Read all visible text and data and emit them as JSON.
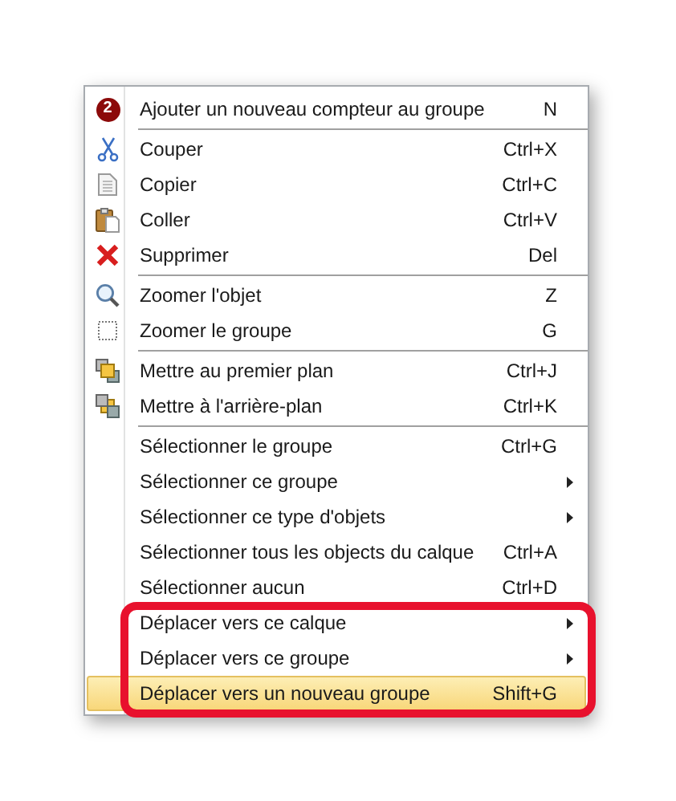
{
  "menu": {
    "items": [
      {
        "kind": "item",
        "badge": "2",
        "label": "Ajouter un nouveau compteur au groupe",
        "shortcut": "N",
        "submenu": false,
        "selected": false,
        "annotated": false
      },
      {
        "kind": "separator"
      },
      {
        "kind": "item",
        "label": "Couper",
        "shortcut": "Ctrl+X",
        "submenu": false,
        "selected": false,
        "annotated": false
      },
      {
        "kind": "item",
        "label": "Copier",
        "shortcut": "Ctrl+C",
        "submenu": false,
        "selected": false,
        "annotated": false
      },
      {
        "kind": "item",
        "label": "Coller",
        "shortcut": "Ctrl+V",
        "submenu": false,
        "selected": false,
        "annotated": false
      },
      {
        "kind": "item",
        "label": "Supprimer",
        "shortcut": "Del",
        "submenu": false,
        "selected": false,
        "annotated": false
      },
      {
        "kind": "separator"
      },
      {
        "kind": "item",
        "label": "Zoomer l'objet",
        "shortcut": "Z",
        "submenu": false,
        "selected": false,
        "annotated": false
      },
      {
        "kind": "item",
        "label": "Zoomer le groupe",
        "shortcut": "G",
        "submenu": false,
        "selected": false,
        "annotated": false
      },
      {
        "kind": "separator"
      },
      {
        "kind": "item",
        "label": "Mettre au premier plan",
        "shortcut": "Ctrl+J",
        "submenu": false,
        "selected": false,
        "annotated": false
      },
      {
        "kind": "item",
        "label": "Mettre à l'arrière-plan",
        "shortcut": "Ctrl+K",
        "submenu": false,
        "selected": false,
        "annotated": false
      },
      {
        "kind": "separator"
      },
      {
        "kind": "item",
        "label": "Sélectionner le groupe",
        "shortcut": "Ctrl+G",
        "submenu": false,
        "selected": false,
        "annotated": false
      },
      {
        "kind": "item",
        "label": "Sélectionner ce groupe",
        "submenu": true,
        "selected": false,
        "annotated": false
      },
      {
        "kind": "item",
        "label": "Sélectionner ce type d'objets",
        "submenu": true,
        "selected": false,
        "annotated": false
      },
      {
        "kind": "item",
        "label": "Sélectionner tous les objects du calque",
        "shortcut": "Ctrl+A",
        "submenu": false,
        "selected": false,
        "annotated": false
      },
      {
        "kind": "item",
        "label": "Sélectionner aucun",
        "shortcut": "Ctrl+D",
        "submenu": false,
        "selected": false,
        "annotated": false
      },
      {
        "kind": "item",
        "label": "Déplacer vers ce calque",
        "submenu": true,
        "selected": false,
        "annotated": true
      },
      {
        "kind": "item",
        "label": "Déplacer vers ce groupe",
        "submenu": true,
        "selected": false,
        "annotated": true
      },
      {
        "kind": "item",
        "label": "Déplacer vers un nouveau groupe",
        "shortcut": "Shift+G",
        "submenu": false,
        "selected": true,
        "annotated": true
      }
    ],
    "annotation": {
      "color": "#e8112d"
    }
  }
}
